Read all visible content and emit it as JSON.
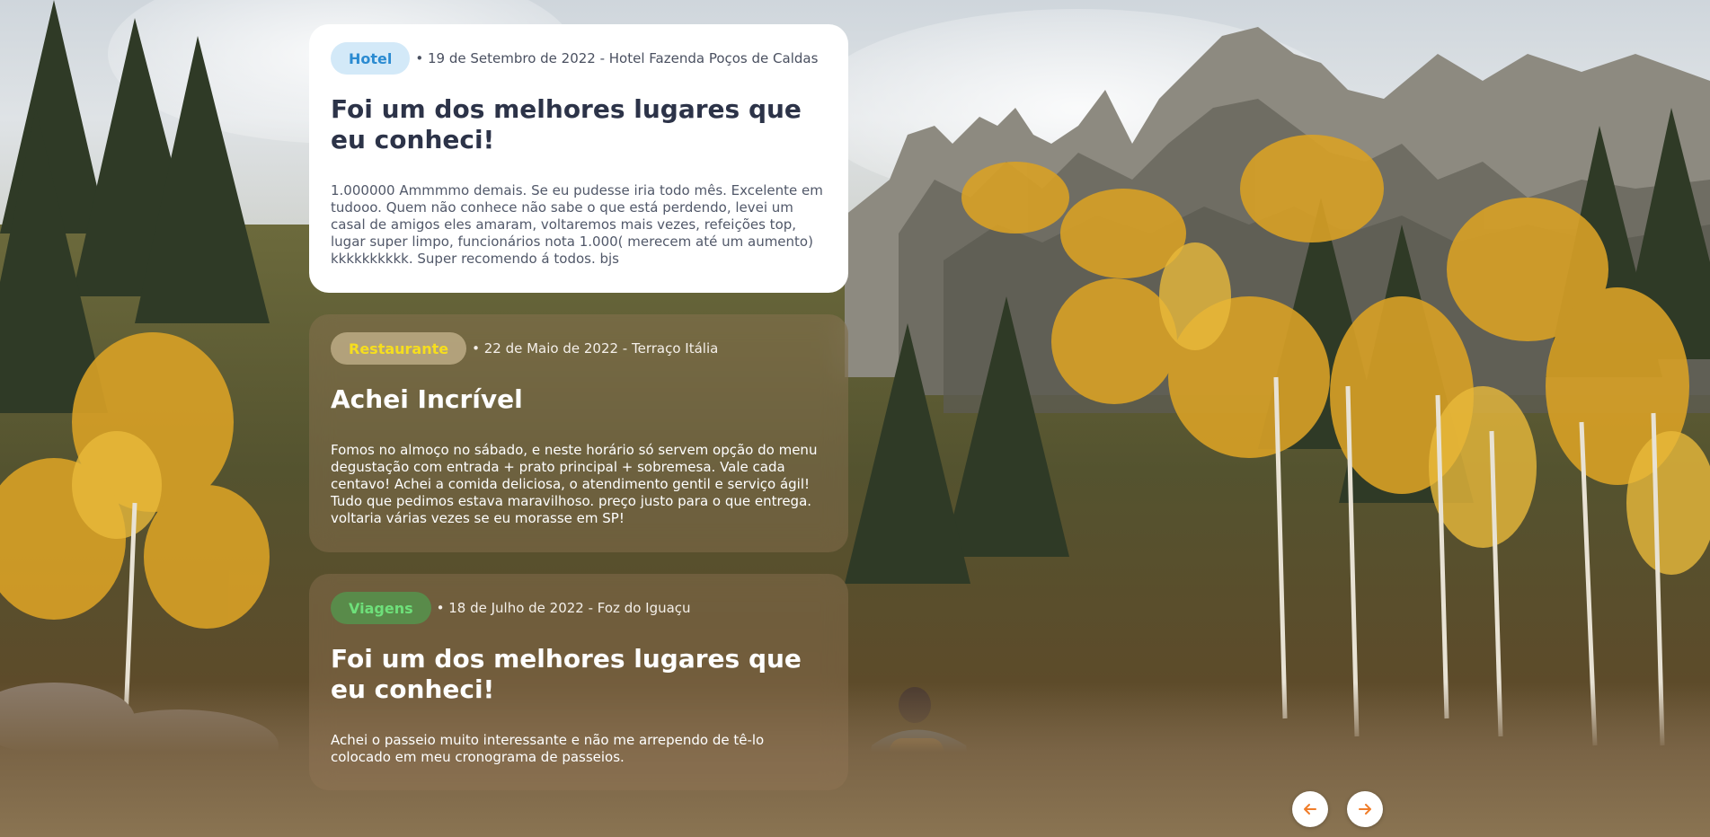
{
  "reviews": [
    {
      "tag": "Hotel",
      "meta": "• 19 de Setembro de 2022 - Hotel Fazenda Poços de Caldas",
      "title": "Foi um dos melhores lugares que eu conheci!",
      "body": "1.000000 Ammmmo demais. Se eu pudesse iria todo mês. Excelente em tudooo. Quem não conhece não sabe o que está perdendo, levei um casal de amigos eles amaram, voltaremos mais vezes, refeições top, lugar super limpo, funcionários nota 1.000( merecem até um aumento) kkkkkkkkkk. Super recomendo á todos. bjs"
    },
    {
      "tag": "Restaurante",
      "meta": "• 22 de Maio de 2022 - Terraço Itália",
      "title": "Achei Incrível",
      "body": "Fomos no almoço no sábado, e neste horário só servem opção do menu degustação com entrada + prato principal + sobremesa. Vale cada centavo! Achei a comida deliciosa, o atendimento gentil e serviço ágil! Tudo que pedimos estava maravilhoso. preço justo para o que entrega. voltaria várias vezes se eu morasse em SP!"
    },
    {
      "tag": "Viagens",
      "meta": "• 18 de Julho de 2022 - Foz do Iguaçu",
      "title": "Foi um dos melhores lugares que eu conheci!",
      "body": "Achei o passeio muito interessante e não me arrependo de tê-lo colocado em meu cronograma de passeios."
    }
  ],
  "nav": {
    "prev_icon": "arrow-left-icon",
    "next_icon": "arrow-right-icon",
    "arrow_color": "#f07d2a"
  },
  "colors": {
    "hotel_tag_bg": "#d3e9f8",
    "hotel_tag_text": "#2b8bd1",
    "restaurant_tag_text": "#f6de1e",
    "trips_tag_text": "#6ee07a",
    "title_dark": "#2c3348"
  }
}
